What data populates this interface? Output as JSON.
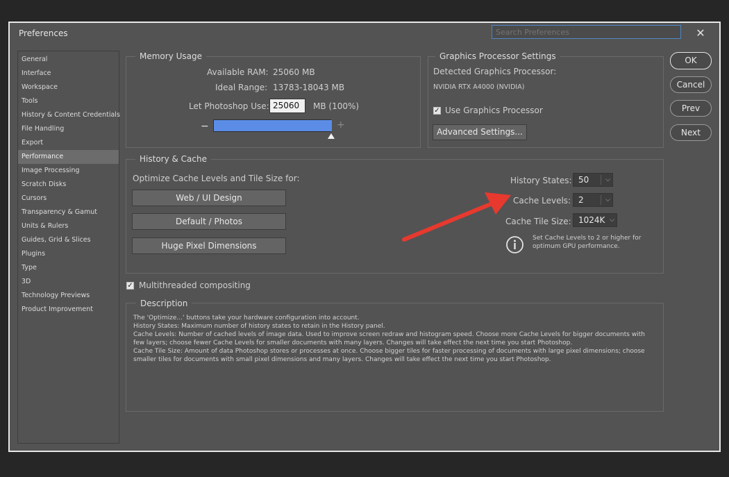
{
  "window": {
    "title": "Preferences",
    "search_placeholder": "Search Preferences",
    "close_glyph": "✕"
  },
  "sidebar": {
    "items": [
      {
        "label": "General"
      },
      {
        "label": "Interface"
      },
      {
        "label": "Workspace"
      },
      {
        "label": "Tools"
      },
      {
        "label": "History & Content Credentials"
      },
      {
        "label": "File Handling"
      },
      {
        "label": "Export"
      },
      {
        "label": "Performance"
      },
      {
        "label": "Image Processing"
      },
      {
        "label": "Scratch Disks"
      },
      {
        "label": "Cursors"
      },
      {
        "label": "Transparency & Gamut"
      },
      {
        "label": "Units & Rulers"
      },
      {
        "label": "Guides, Grid & Slices"
      },
      {
        "label": "Plugins"
      },
      {
        "label": "Type"
      },
      {
        "label": "3D"
      },
      {
        "label": "Technology Previews"
      },
      {
        "label": "Product Improvement"
      }
    ],
    "selected_index": 7
  },
  "memory": {
    "legend": "Memory Usage",
    "available_label": "Available RAM:",
    "available_value": "25060 MB",
    "ideal_label": "Ideal Range:",
    "ideal_value": "13783-18043 MB",
    "use_label": "Let Photoshop Use:",
    "use_value": "25060",
    "use_unit": "MB (100%)",
    "minus": "−",
    "plus": "+",
    "slider_fraction": 1.0
  },
  "gpu": {
    "legend": "Graphics Processor Settings",
    "detected_label": "Detected Graphics Processor:",
    "detected_value": "NVIDIA RTX A4000 (NVIDIA)",
    "use_gpu_label": "Use Graphics Processor",
    "use_gpu_checked": true,
    "advanced_button": "Advanced Settings..."
  },
  "history_cache": {
    "legend": "History & Cache",
    "optimize_label": "Optimize Cache Levels and Tile Size for:",
    "buttons": [
      "Web / UI Design",
      "Default / Photos",
      "Huge Pixel Dimensions"
    ],
    "history_states_label": "History States:",
    "history_states_value": "50",
    "cache_levels_label": "Cache Levels:",
    "cache_levels_value": "2",
    "tile_size_label": "Cache Tile Size:",
    "tile_size_value": "1024K",
    "info_line1": "Set Cache Levels to 2 or higher for",
    "info_line2": "optimum GPU performance."
  },
  "multithreaded": {
    "label": "Multithreaded compositing",
    "checked": true
  },
  "description": {
    "legend": "Description",
    "lines": [
      "The 'Optimize...' buttons take your hardware configuration into account.",
      "History States: Maximum number of history states to retain in the History panel.",
      "Cache Levels: Number of cached levels of image data.  Used to improve screen redraw and histogram speed.  Choose more Cache Levels for bigger documents with",
      "few layers; choose fewer Cache Levels for smaller documents with many layers. Changes will take effect the next time you start Photoshop.",
      "Cache Tile Size: Amount of data Photoshop stores or processes at once. Choose bigger tiles for faster processing of documents with large pixel dimensions; choose",
      "smaller tiles for documents with small pixel dimensions and many layers. Changes will take effect the next time you start Photoshop."
    ]
  },
  "buttons": {
    "ok": "OK",
    "cancel": "Cancel",
    "prev": "Prev",
    "next": "Next"
  },
  "colors": {
    "accent": "#5b8de6",
    "annotation_arrow": "#e8392f",
    "dialog_bg": "#535353"
  }
}
